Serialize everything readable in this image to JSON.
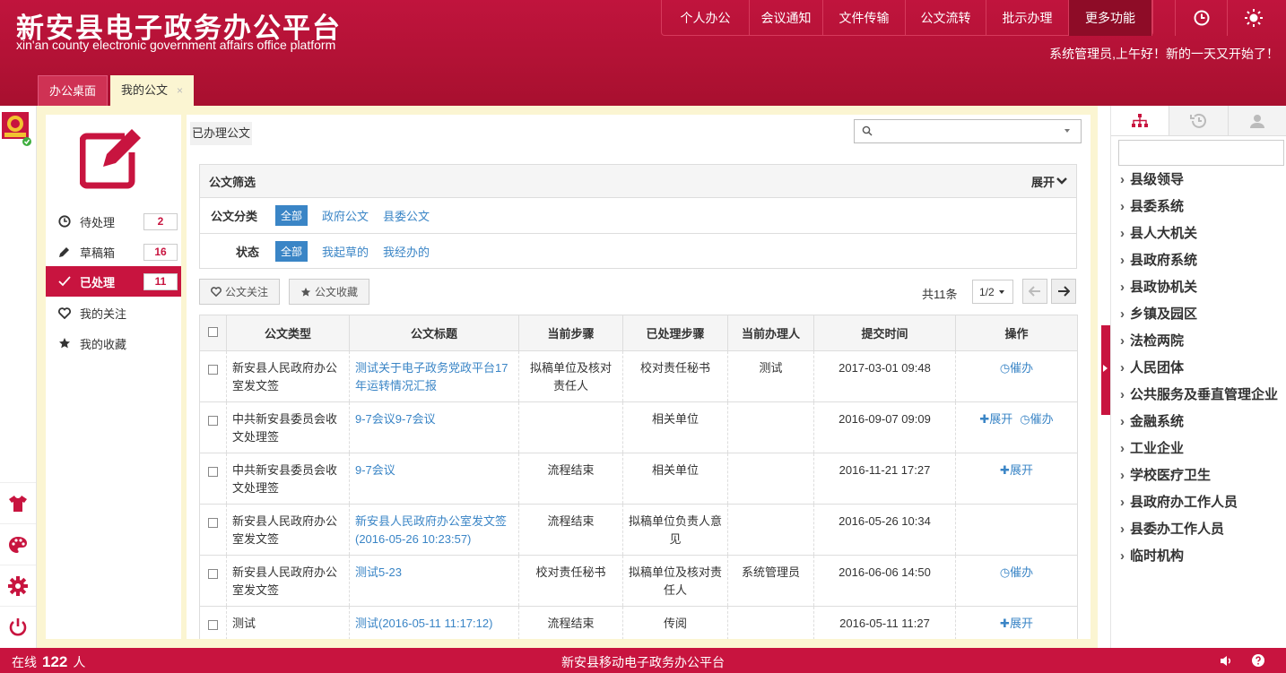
{
  "app": {
    "title": "新安县电子政务办公平台",
    "subtitle": "xin'an county electronic government affairs office platform",
    "greeting": "系统管理员,上午好！新的一天又开始了！"
  },
  "topnav": [
    "个人办公",
    "会议通知",
    "文件传输",
    "公文流转",
    "批示办理",
    "更多功能"
  ],
  "tabs": {
    "home": "办公桌面",
    "active": "我的公文",
    "close": "×"
  },
  "side_menu": {
    "items": [
      {
        "label": "待处理",
        "badge": "2",
        "icon": "clock-icon"
      },
      {
        "label": "草稿箱",
        "badge": "16",
        "icon": "pencil-icon"
      },
      {
        "label": "已处理",
        "badge": "11",
        "icon": "check-icon"
      },
      {
        "label": "我的关注",
        "icon": "heart-icon"
      },
      {
        "label": "我的收藏",
        "icon": "star-icon"
      }
    ]
  },
  "main": {
    "crumb": "已办理公文",
    "search_placeholder": "",
    "filter": {
      "title": "公文筛选",
      "expand": "展开",
      "rows": [
        {
          "label": "公文分类",
          "options": [
            "全部",
            "政府公文",
            "县委公文"
          ]
        },
        {
          "label": "状态",
          "options": [
            "全部",
            "我起草的",
            "我经办的"
          ]
        }
      ]
    },
    "actions": {
      "follow": "公文关注",
      "favorite": "公文收藏",
      "total": "共11条",
      "page": "1/2"
    },
    "table": {
      "headers": [
        "公文类型",
        "公文标题",
        "当前步骤",
        "已处理步骤",
        "当前办理人",
        "提交时间",
        "操作"
      ],
      "rows": [
        {
          "type": "新安县人民政府办公室发文签",
          "title": "测试关于电子政务党政平台17年运转情况汇报",
          "step": "拟稿单位及核对责任人",
          "done": "校对责任秘书",
          "handler": "测试",
          "time": "2017-03-01 09:48",
          "ops": [
            "催办"
          ]
        },
        {
          "type": "中共新安县委员会收文处理签",
          "title": "9-7会议9-7会议",
          "step": "",
          "done": "相关单位",
          "handler": "",
          "time": "2016-09-07 09:09",
          "ops": [
            "展开",
            "催办"
          ]
        },
        {
          "type": "中共新安县委员会收文处理签",
          "title": "9-7会议",
          "step": "流程结束",
          "done": "相关单位",
          "handler": "",
          "time": "2016-11-21 17:27",
          "ops": [
            "展开"
          ]
        },
        {
          "type": "新安县人民政府办公室发文签",
          "title": "新安县人民政府办公室发文签(2016-05-26 10:23:57)",
          "step": "流程结束",
          "done": "拟稿单位负责人意见",
          "handler": "",
          "time": "2016-05-26 10:34",
          "ops": []
        },
        {
          "type": "新安县人民政府办公室发文签",
          "title": "测试5-23",
          "step": "校对责任秘书",
          "done": "拟稿单位及核对责任人",
          "handler": "系统管理员",
          "time": "2016-06-06 14:50",
          "ops": [
            "催办"
          ]
        },
        {
          "type": "测试",
          "title": "测试(2016-05-11 11:17:12)",
          "step": "流程结束",
          "done": "传阅",
          "handler": "",
          "time": "2016-05-11 11:27",
          "ops": [
            "展开"
          ]
        }
      ]
    }
  },
  "org_tree": [
    "县级领导",
    "县委系统",
    "县人大机关",
    "县政府系统",
    "县政协机关",
    "乡镇及园区",
    "法检两院",
    "人民团体",
    "公共服务及垂直管理企业",
    "金融系统",
    "工业企业",
    "学校医疗卫生",
    "县政府办工作人员",
    "县委办工作人员",
    "临时机构"
  ],
  "footer": {
    "online_label": "在线",
    "online_count": "122",
    "online_unit": "人",
    "title": "新安县移动电子政务办公平台"
  },
  "colors": {
    "brand": "#c8143f",
    "link": "#3a85c6",
    "content_bg": "#fbf5d2"
  }
}
